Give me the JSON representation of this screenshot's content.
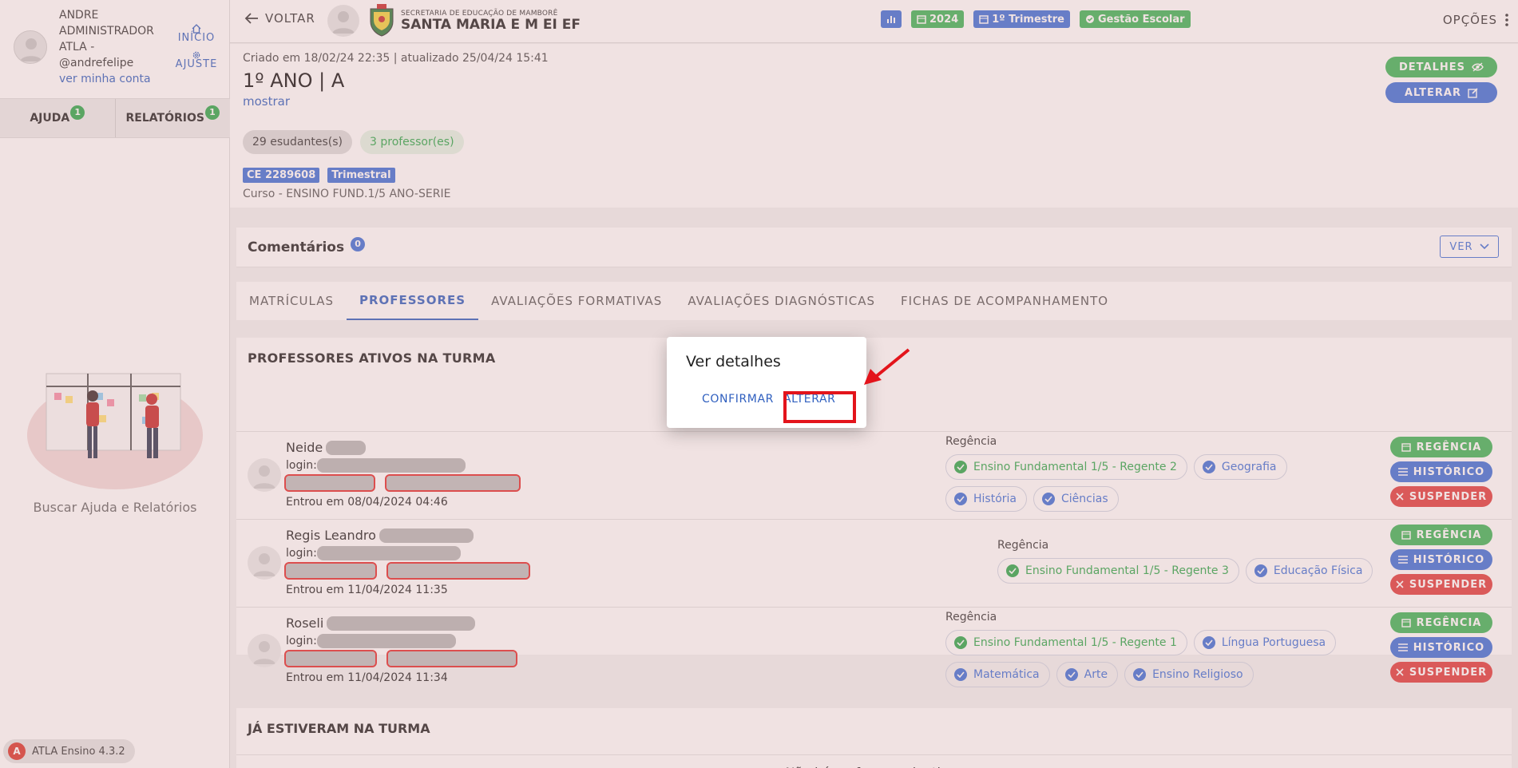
{
  "user": {
    "name_lines": [
      "ANDRE",
      "ADMINISTRADOR",
      "ATLA -"
    ],
    "handle": "@andrefelipe",
    "account_link": "ver minha conta"
  },
  "quick_links": {
    "home": "INÍCIO",
    "settings": "AJUSTE"
  },
  "sidebar_tabs": [
    {
      "label": "AJUDA",
      "badge": "1"
    },
    {
      "label": "RELATÓRIOS",
      "badge": "1"
    }
  ],
  "help_caption": "Buscar Ajuda e Relatórios",
  "version": {
    "logo_letter": "A",
    "label": "ATLA Ensino 4.3.2"
  },
  "topbar": {
    "back_label": "VOLTAR",
    "school_subtitle": "SECRETARIA DE EDUCAÇÃO DE MAMBORÊ",
    "school_name": "SANTA MARIA E M EI EF",
    "chips": [
      {
        "label": "",
        "icon": "bar-chart-icon",
        "color": "blue"
      },
      {
        "label": "2024",
        "icon": "calendar-icon",
        "color": "green"
      },
      {
        "label": "1º Trimestre",
        "icon": "calendar-icon",
        "color": "blue"
      },
      {
        "label": "Gestão Escolar",
        "icon": "check-circle-icon",
        "color": "green"
      }
    ],
    "options_label": "OPÇÕES"
  },
  "class_header": {
    "meta": "Criado em 18/02/24 22:35 | atualizado 25/04/24 15:41",
    "title": "1º ANO | A",
    "show_link": "mostrar",
    "students_pill": "29 esudantes(s)",
    "teachers_pill": "3 professor(es)",
    "tags": [
      "CE 2289608",
      "Trimestral"
    ],
    "course": "Curso - ENSINO FUND.1/5 ANO-SERIE",
    "details_button": "DETALHES",
    "alter_button": "ALTERAR"
  },
  "comments": {
    "title": "Comentários",
    "count": "0",
    "see_button": "VER"
  },
  "tabs": [
    {
      "label": "MATRÍCULAS",
      "active": false
    },
    {
      "label": "PROFESSORES",
      "active": true
    },
    {
      "label": "AVALIAÇÕES FORMATIVAS",
      "active": false
    },
    {
      "label": "AVALIAÇÕES DIAGNÓSTICAS",
      "active": false
    },
    {
      "label": "FICHAS DE ACOMPANHAMENTO",
      "active": false
    }
  ],
  "active_section": {
    "title": "PROFESSORES ATIVOS NA TURMA",
    "regency_label": "Regência",
    "action_labels": {
      "regency": "REGÊNCIA",
      "history": "HISTÓRICO",
      "suspend": "SUSPENDER"
    },
    "login_label": "login:",
    "teachers": [
      {
        "name": "Neide",
        "joined": "Entrou em 08/04/2024 04:46",
        "subjects": [
          {
            "label": "Ensino Fundamental 1/5 - Regente 2",
            "color": "green"
          },
          {
            "label": "Geografia",
            "color": "blue"
          },
          {
            "label": "História",
            "color": "blue"
          },
          {
            "label": "Ciências",
            "color": "blue"
          }
        ]
      },
      {
        "name": "Regis Leandro",
        "joined": "Entrou em 11/04/2024 11:35",
        "subjects": [
          {
            "label": "Ensino Fundamental 1/5 - Regente 3",
            "color": "green"
          },
          {
            "label": "Educação Física",
            "color": "blue"
          }
        ]
      },
      {
        "name": "Roseli",
        "joined": "Entrou em 11/04/2024 11:34",
        "subjects": [
          {
            "label": "Ensino Fundamental 1/5 - Regente 1",
            "color": "green"
          },
          {
            "label": "Língua Portuguesa",
            "color": "blue"
          },
          {
            "label": "Matemática",
            "color": "blue"
          },
          {
            "label": "Arte",
            "color": "blue"
          },
          {
            "label": "Ensino Religioso",
            "color": "blue"
          }
        ]
      }
    ]
  },
  "inactive_section": {
    "title": "JÁ ESTIVERAM NA TURMA",
    "empty": "Não há professores inativos"
  },
  "dialog": {
    "title": "Ver detalhes",
    "confirm": "CONFIRMAR",
    "alter": "ALTERAR"
  },
  "colors": {
    "primary_blue": "#3b6fd8",
    "success_green": "#3bb557",
    "danger_red": "#e03c3c",
    "highlight_red": "#e3141b"
  }
}
